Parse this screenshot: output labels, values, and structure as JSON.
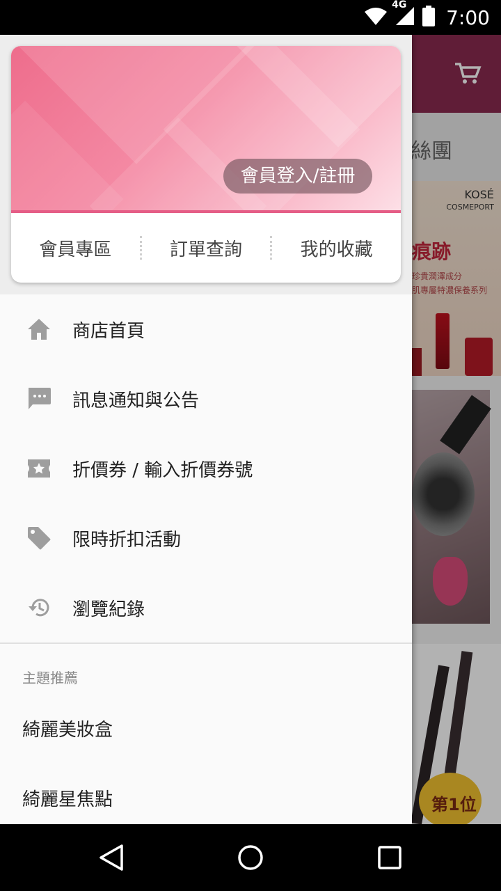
{
  "status_bar": {
    "time": "7:00",
    "network": "4G",
    "icons": [
      "wifi-icon",
      "signal-icon",
      "battery-icon"
    ]
  },
  "background": {
    "tab_partial_text": "絲團",
    "banner": {
      "brand": "KOSÉ",
      "brand_sub": "COSMEPORT",
      "title_partial": "痕跡",
      "line1": "珍貴潤澤成分",
      "line2": "肌專屬特濃保養系列"
    },
    "badge_text": "第1位"
  },
  "drawer": {
    "login_label": "會員登入/註冊",
    "quick_actions": [
      {
        "label": "會員專區"
      },
      {
        "label": "訂單查詢"
      },
      {
        "label": "我的收藏"
      }
    ],
    "menu": [
      {
        "label": "商店首頁",
        "icon": "home-icon"
      },
      {
        "label": "訊息通知與公告",
        "icon": "message-icon"
      },
      {
        "label": "折價券 / 輸入折價券號",
        "icon": "coupon-icon"
      },
      {
        "label": "限時折扣活動",
        "icon": "tag-icon"
      },
      {
        "label": "瀏覽紀錄",
        "icon": "history-icon"
      }
    ],
    "section_title": "主題推薦",
    "topics": [
      {
        "label": "綺麗美妝盒"
      },
      {
        "label": "綺麗星焦點"
      }
    ]
  },
  "colors": {
    "accent_pink": "#e55d86",
    "header_bg": "#8a2a4f",
    "icon_gray": "#9e9e9e"
  }
}
